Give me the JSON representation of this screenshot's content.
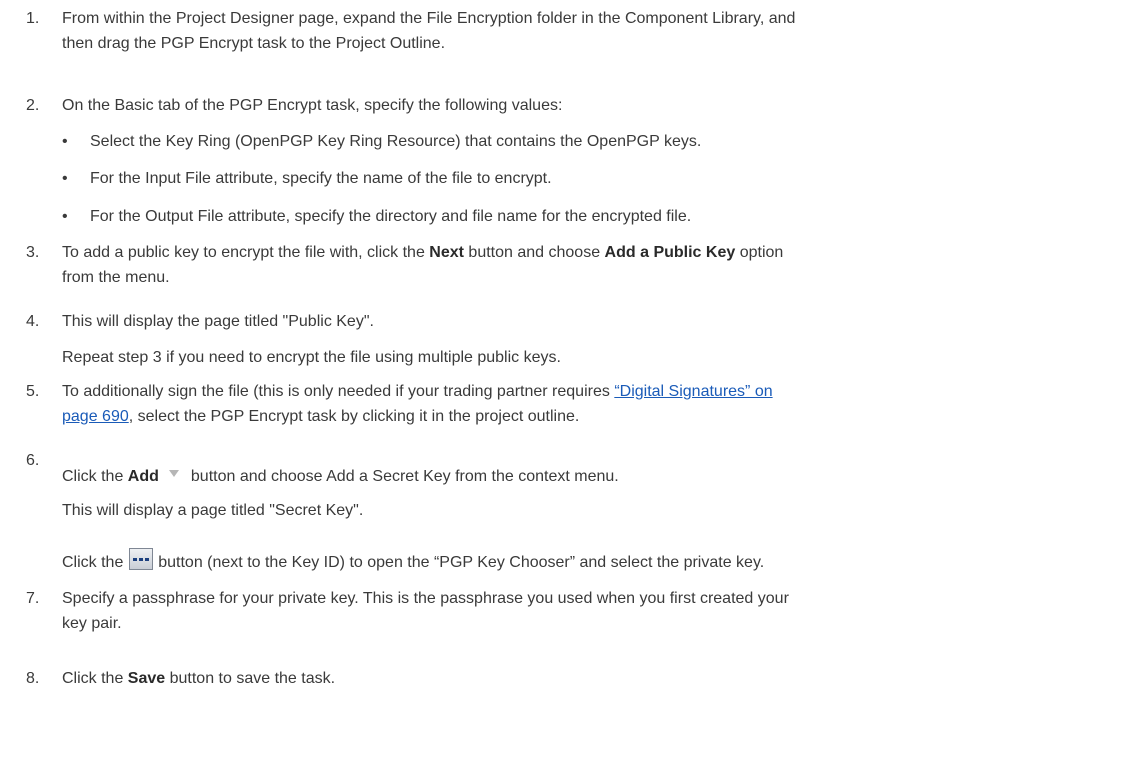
{
  "steps": [
    {
      "num": "1.",
      "lines": [
        "From within the Project Designer page, expand the File Encryption folder in the Component Library, and",
        "then drag the PGP Encrypt task to the Project Outline."
      ]
    },
    {
      "num": "2.",
      "text": "On the Basic tab of the PGP Encrypt task, specify the following values:"
    },
    {
      "num": "3.",
      "pre": "To add a public key to encrypt the file with, click the ",
      "b1": "Next",
      "mid": " button and choose ",
      "b2": "Add a Public Key",
      "post": " option",
      "line2": "from the menu."
    },
    {
      "num": "4.",
      "text": "This will display the page titled \"Public Key\".",
      "note": "Repeat step 3 if you need to encrypt the file using multiple public keys."
    },
    {
      "num": "5.",
      "pre": "To additionally sign the file (this is only needed if your trading partner requires ",
      "link1": "“Digital Signatures” on",
      "link2": "page 690",
      "post": ", select the PGP Encrypt task by clicking it in the project outline."
    },
    {
      "num": "6.",
      "pre": "Click the ",
      "b1": "Add",
      "post": "button and choose Add a Secret Key from the context menu.",
      "line2": "This will display a page titled \"Secret Key\".",
      "line3_pre": "Click the ",
      "line3_post": " button (next to the Key ID) to open the “PGP Key Chooser” and select the private key."
    },
    {
      "num": "7.",
      "lines": [
        "Specify a passphrase for your private key.  This is the passphrase you used when you first created your",
        "key pair."
      ]
    },
    {
      "num": "8.",
      "pre": "Click the ",
      "b1": "Save",
      "post": " button to save the task."
    }
  ],
  "bullets": [
    "Select the Key Ring (OpenPGP Key Ring Resource) that contains the OpenPGP keys.",
    "For the Input File attribute, specify the name of the file to encrypt.",
    "For the Output File attribute, specify the directory and file name for the encrypted file."
  ],
  "bullet_char": "•",
  "icons": {
    "dropdown": "chevron-down-icon",
    "browse": "ellipsis-button-icon"
  },
  "colors": {
    "text": "#3a3a3a",
    "link": "#1a5bb8"
  }
}
